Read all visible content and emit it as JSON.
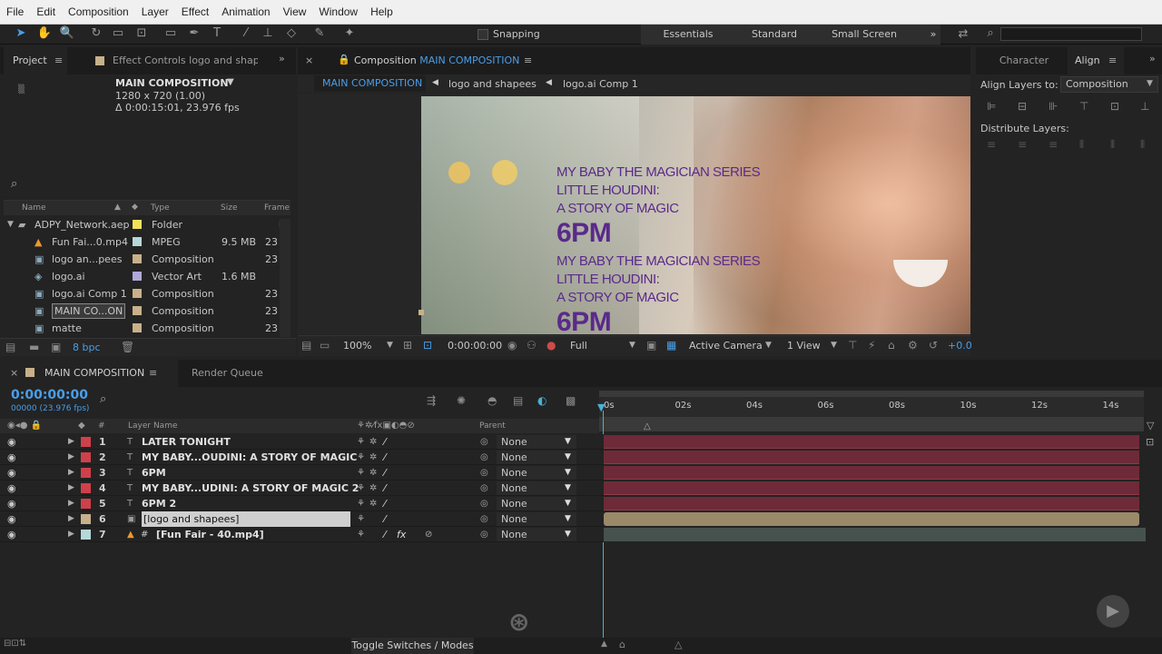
{
  "menu": [
    "File",
    "Edit",
    "Composition",
    "Layer",
    "Effect",
    "Animation",
    "View",
    "Window",
    "Help"
  ],
  "toolbar": {
    "snapping": "Snapping"
  },
  "workspaces": [
    "Essentials",
    "Standard",
    "Small Screen"
  ],
  "project": {
    "tab": "Project",
    "effect_tab": "Effect Controls logo and shape",
    "comp_name": "MAIN COMPOSITION",
    "comp_res": "1280 x 720 (1.00)",
    "comp_dur": "Δ 0:00:15:01, 23.976 fps",
    "search_icon": "search-icon",
    "columns": [
      "Name",
      "Type",
      "Size",
      "Frame"
    ],
    "items": [
      {
        "name": "ADPY_Network.aep",
        "type": "Folder",
        "size": "",
        "frame": "",
        "color": "#f2e25a",
        "icon": "folder-icon"
      },
      {
        "name": "Fun Fai...0.mp4",
        "type": "MPEG",
        "size": "9.5 MB",
        "frame": "23",
        "color": "#b5d8d8",
        "icon": "video-icon"
      },
      {
        "name": "logo an...pees",
        "type": "Composition",
        "size": "",
        "frame": "23",
        "color": "#c8b08a",
        "icon": "comp-icon"
      },
      {
        "name": "logo.ai",
        "type": "Vector Art",
        "size": "1.6 MB",
        "frame": "",
        "color": "#b0a8d8",
        "icon": "ai-icon"
      },
      {
        "name": "logo.ai Comp 1",
        "type": "Composition",
        "size": "",
        "frame": "23",
        "color": "#c8b08a",
        "icon": "comp-icon"
      },
      {
        "name": "MAIN CO...ON",
        "type": "Composition",
        "size": "",
        "frame": "23",
        "color": "#c8b08a",
        "icon": "comp-icon"
      },
      {
        "name": "matte",
        "type": "Composition",
        "size": "",
        "frame": "23",
        "color": "#c8b08a",
        "icon": "comp-icon"
      }
    ],
    "bpc": "8 bpc"
  },
  "viewer": {
    "tab_prefix": "Composition",
    "tab_name": "MAIN COMPOSITION",
    "crumbs": [
      "MAIN COMPOSITION",
      "logo and shapees",
      "logo.ai Comp 1"
    ],
    "text_block": [
      "MY BABY THE MAGICIAN SERIES",
      "LITTLE HOUDINI:",
      "A STORY OF MAGIC",
      "6PM"
    ],
    "zoom": "100%",
    "timecode": "0:00:00:00",
    "quality": "Full",
    "camera": "Active Camera",
    "views": "1 View",
    "exposure": "+0.0"
  },
  "align": {
    "tab_char": "Character",
    "tab_align": "Align",
    "align_to_label": "Align Layers to:",
    "align_to_value": "Composition",
    "distribute_label": "Distribute Layers:"
  },
  "timeline": {
    "tab": "MAIN COMPOSITION",
    "render_tab": "Render Queue",
    "timecode": "0:00:00:00",
    "fps": "00000 (23.976 fps)",
    "col_layer": "Layer Name",
    "col_parent": "Parent",
    "rulers": [
      "0s",
      "02s",
      "04s",
      "06s",
      "08s",
      "10s",
      "12s",
      "14s"
    ],
    "layers": [
      {
        "num": "1",
        "name": "LATER TONIGHT",
        "color": "#d0404a",
        "type": "T",
        "parent": "None"
      },
      {
        "num": "2",
        "name": "MY BABY...OUDINI: A STORY OF MAGIC",
        "color": "#d0404a",
        "type": "T",
        "parent": "None"
      },
      {
        "num": "3",
        "name": "6PM",
        "color": "#d0404a",
        "type": "T",
        "parent": "None"
      },
      {
        "num": "4",
        "name": "MY BABY...UDINI: A STORY OF MAGIC 2",
        "color": "#d0404a",
        "type": "T",
        "parent": "None"
      },
      {
        "num": "5",
        "name": "6PM 2",
        "color": "#d0404a",
        "type": "T",
        "parent": "None"
      },
      {
        "num": "6",
        "name": "[logo and shapees]",
        "color": "#c8b08a",
        "type": "C",
        "parent": "None"
      },
      {
        "num": "7",
        "name": "[Fun Fair - 40.mp4]",
        "color": "#b5d8d8",
        "type": "V",
        "parent": "None"
      }
    ],
    "toggle": "Toggle Switches / Modes"
  }
}
